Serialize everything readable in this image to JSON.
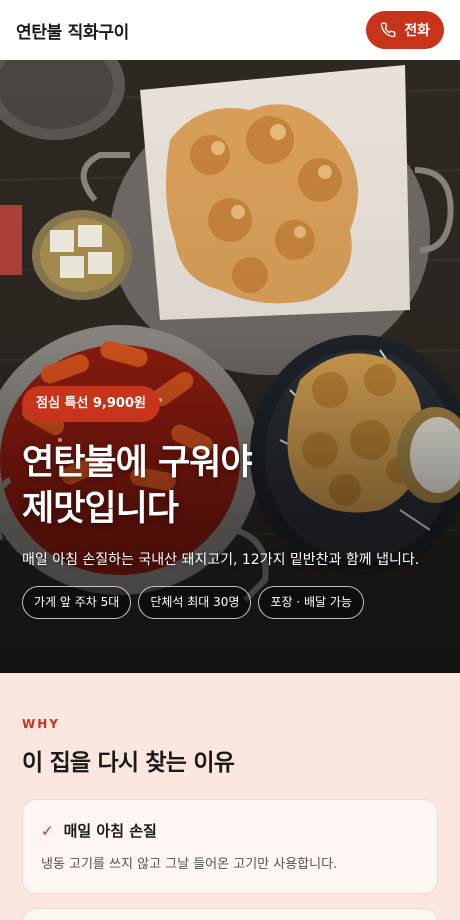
{
  "header": {
    "brand": "연탄불 직화구이",
    "call_label": "전화"
  },
  "hero": {
    "promo_badge": "점심 특선 9,900원",
    "title": "연탄불에 구워야\n제맛입니다",
    "description": "매일 아침 손질하는 국내산 돼지고기, 12가지 밑반찬과 함께 냅니다.",
    "chips": [
      "가게 앞 주차 5대",
      "단체석 최대 30명",
      "포장 · 배달 가능"
    ]
  },
  "why": {
    "eyebrow": "WHY",
    "title": "이 집을 다시 찾는 이유",
    "cards": [
      {
        "icon": "check-icon",
        "title": "매일 아침 손질",
        "body": "냉동 고기를 쓰지 않고 그날 들어온 고기만 사용합니다."
      }
    ]
  },
  "colors": {
    "accent": "#c8341b",
    "section_bg": "#fbe7e0",
    "card_bg": "#fdf6f3"
  }
}
